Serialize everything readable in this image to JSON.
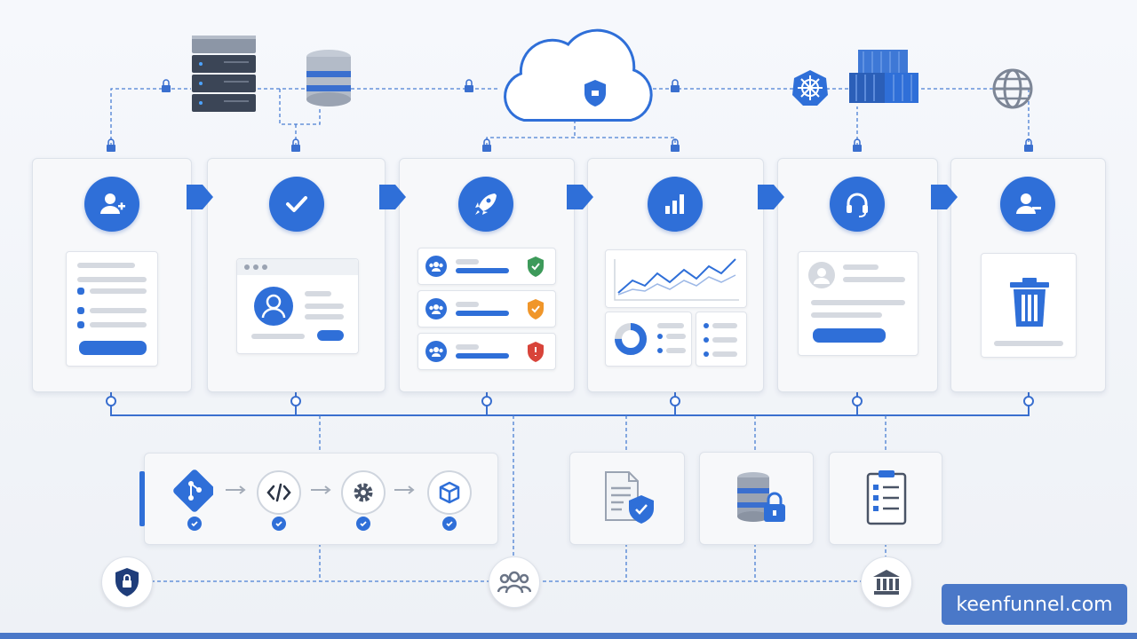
{
  "watermark": {
    "text": "keenfunnel.com"
  },
  "colors": {
    "accent": "#2f6fd8",
    "green": "#3d9a5a",
    "orange": "#f0962a",
    "red": "#d8443a",
    "navy": "#1f3d7a"
  },
  "stages": [
    {
      "icon": "user-add-icon"
    },
    {
      "icon": "checkmark-icon"
    },
    {
      "icon": "rocket-icon"
    },
    {
      "icon": "bar-chart-icon"
    },
    {
      "icon": "headset-icon"
    },
    {
      "icon": "user-remove-icon"
    }
  ],
  "top_icons": [
    "server-rack-icon",
    "database-icon",
    "cloud-icon",
    "kubernetes-icon",
    "container-icon",
    "globe-icon"
  ],
  "pipeline_steps": [
    "git-icon",
    "code-icon",
    "gear-icon",
    "package-icon"
  ],
  "lower_boxes": [
    "document-shield-icon",
    "database-lock-icon",
    "clipboard-checklist-icon"
  ],
  "bottom_icons": [
    "shield-lock-icon",
    "users-group-icon",
    "bank-icon"
  ]
}
